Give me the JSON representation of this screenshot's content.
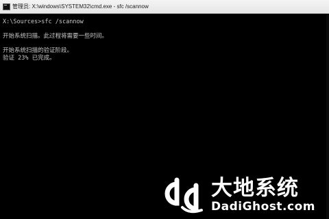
{
  "window": {
    "title": "管理员: X:\\windows\\SYSTEM32\\cmd.exe - sfc  /scannow",
    "icon": "cmd-icon"
  },
  "console": {
    "lines": [
      "X:\\Sources>sfc /scannow",
      "",
      "开始系统扫描。此过程将需要一些时间。",
      "",
      "开始系统扫描的验证阶段。",
      "验证 23% 已完成。"
    ],
    "verification_progress_percent": 23,
    "text_color": "#c8c8c8",
    "background_color": "#000000"
  },
  "watermark": {
    "cn_text": "大地系统",
    "en_text": "DadiGhost.com",
    "logo": "dd-logo"
  }
}
